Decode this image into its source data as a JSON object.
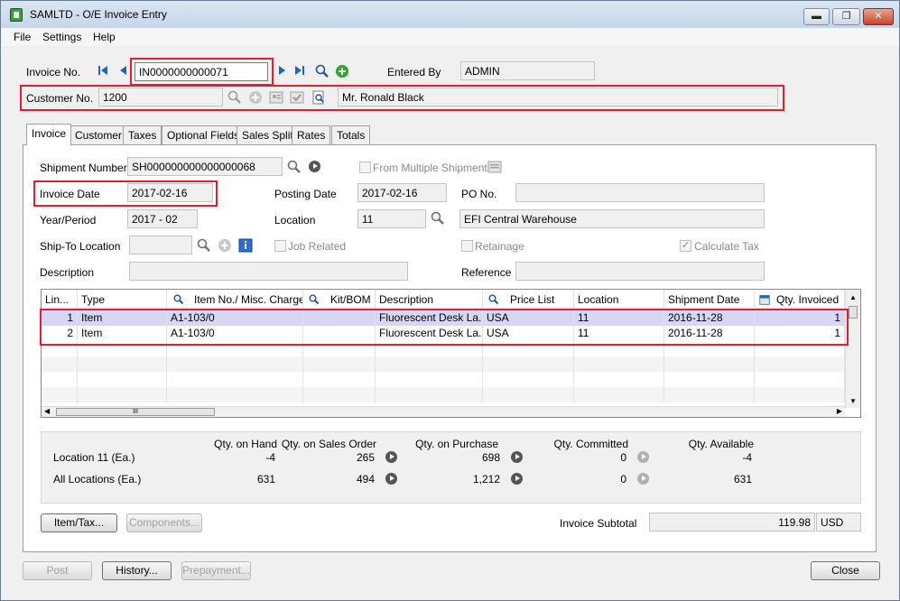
{
  "window": {
    "title": "SAMLTD - O/E Invoice Entry",
    "minimize": "▬",
    "maximize": "❐",
    "close": "✕"
  },
  "menu": {
    "file": "File",
    "settings": "Settings",
    "help": "Help"
  },
  "header": {
    "invoice_no_label": "Invoice No.",
    "invoice_no_value": "IN0000000000071",
    "entered_by_label": "Entered By",
    "entered_by_value": "ADMIN",
    "customer_no_label": "Customer No.",
    "customer_no_value": "1200",
    "customer_name": "Mr. Ronald Black"
  },
  "tabs": [
    {
      "label": "Invoice"
    },
    {
      "label": "Customer"
    },
    {
      "label": "Taxes"
    },
    {
      "label": "Optional Fields"
    },
    {
      "label": "Sales Split"
    },
    {
      "label": "Rates"
    },
    {
      "label": "Totals"
    }
  ],
  "invoice_tab": {
    "shipment_number_label": "Shipment Number",
    "shipment_number_value": "SH000000000000000068",
    "from_multiple_shipments_label": "From Multiple Shipments",
    "invoice_date_label": "Invoice Date",
    "invoice_date_value": "2017-02-16",
    "posting_date_label": "Posting Date",
    "posting_date_value": "2017-02-16",
    "po_no_label": "PO No.",
    "po_no_value": "",
    "year_period_label": "Year/Period",
    "year_period_value": "2017 - 02",
    "location_label": "Location",
    "location_code": "11",
    "location_name": "EFI Central Warehouse",
    "ship_to_location_label": "Ship-To Location",
    "ship_to_value": "",
    "job_related_label": "Job Related",
    "retainage_label": "Retainage",
    "calculate_tax_label": "Calculate Tax",
    "description_label": "Description",
    "description_value": "",
    "reference_label": "Reference",
    "reference_value": ""
  },
  "grid": {
    "columns": [
      "Lin...",
      "Type",
      "Item No./ Misc. Charge",
      "Kit/BOM",
      "Description",
      "Price List",
      "Location",
      "Shipment Date",
      "Qty. Invoiced"
    ],
    "rows": [
      [
        "1",
        "Item",
        "A1-103/0",
        "",
        "Fluorescent Desk La...",
        "USA",
        "11",
        "2016-11-28",
        "1"
      ],
      [
        "2",
        "Item",
        "A1-103/0",
        "",
        "Fluorescent Desk La...",
        "USA",
        "11",
        "2016-11-28",
        "1"
      ]
    ],
    "hscroll_grip": "III"
  },
  "summary": {
    "headers": [
      "Qty. on Hand",
      "Qty. on Sales Order",
      "Qty. on Purchase",
      "Qty. Committed",
      "Qty. Available"
    ],
    "location_label": "Location  11 (Ea.)",
    "all_locations_label": "All Locations (Ea.)",
    "location_values": [
      "-4",
      "265",
      "698",
      "0",
      "-4"
    ],
    "all_values": [
      "631",
      "494",
      "1,212",
      "0",
      "631"
    ]
  },
  "lower": {
    "item_tax_button": "Item/Tax...",
    "components_button": "Components...",
    "invoice_subtotal_label": "Invoice Subtotal",
    "invoice_subtotal_value": "119.98",
    "currency": "USD"
  },
  "footer": {
    "post_button": "Post",
    "history_button": "History...",
    "prepayment_button": "Prepayment...",
    "close_button": "Close"
  },
  "colors": {
    "highlight": "#e02030",
    "selected_row": "#d9d6f5",
    "accent": "#1e63c7"
  }
}
